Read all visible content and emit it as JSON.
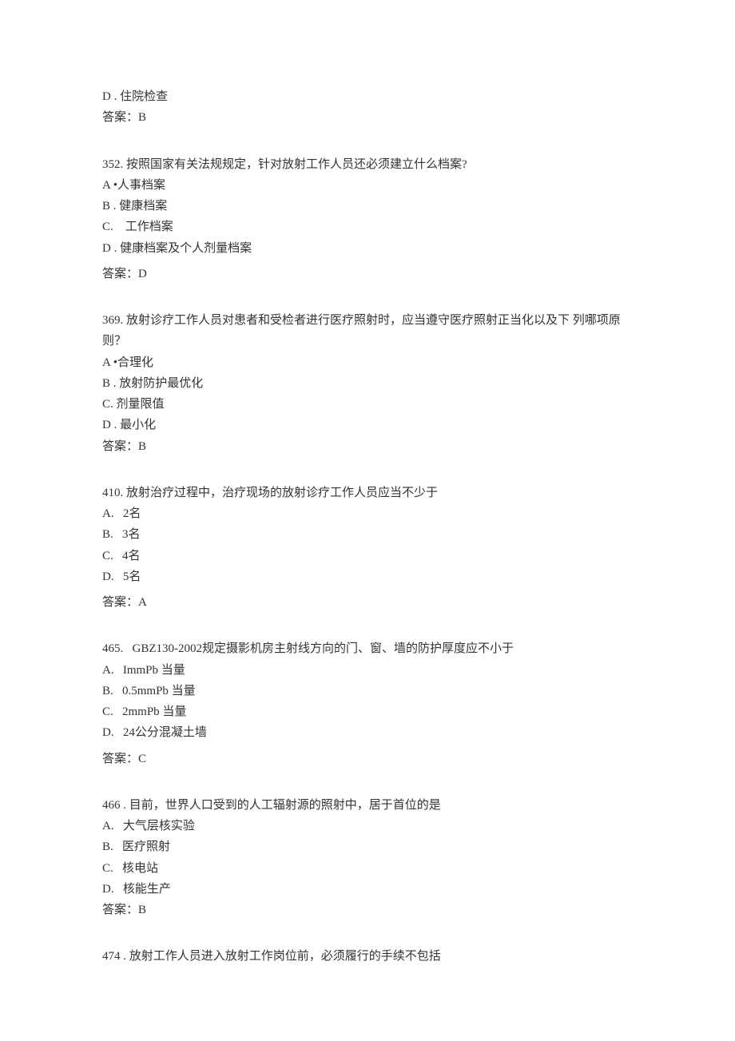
{
  "intro": {
    "optionD": "D . 住院检查",
    "answer": "答案：B"
  },
  "questions": [
    {
      "stem": "352. 按照国家有关法规规定，针对放射工作人员还必须建立什么档案?",
      "options": [
        "A •人事档案",
        "B . 健康档案",
        "C.    工作档案",
        "D . 健康档案及个人剂量档案"
      ],
      "answer": "答案：D",
      "answerSpaced": true
    },
    {
      "stem": "369. 放射诊疗工作人员对患者和受检者进行医疗照射时，应当遵守医疗照射正当化以及下 列哪项原则？",
      "options": [
        "A •合理化",
        "B . 放射防护最优化",
        "C. 剂量限值",
        "D . 最小化"
      ],
      "answer": "答案：B",
      "answerSpaced": false
    },
    {
      "stem": "410. 放射治疗过程中，治疗现场的放射诊疗工作人员应当不少于",
      "options": [
        "A.   2名",
        "B.   3名",
        "C.   4名",
        "D.   5名"
      ],
      "answer": "答案：A",
      "answerSpaced": true
    },
    {
      "stem": "465.   GBZ130-2002规定摄影机房主射线方向的门、窗、墙的防护厚度应不小于",
      "options": [
        "A.   ImmPb 当量",
        "B.   0.5mmPb 当量",
        "C.   2mmPb 当量",
        "D.   24公分混凝土墙"
      ],
      "answer": "答案：C",
      "answerSpaced": true
    },
    {
      "stem": "466 . 目前，世界人口受到的人工辐射源的照射中，居于首位的是",
      "options": [
        "A.   大气层核实验",
        "B.   医疗照射",
        "C.   核电站",
        "D.   核能生产"
      ],
      "answer": "答案：B",
      "answerSpaced": false
    },
    {
      "stem": "474 . 放射工作人员进入放射工作岗位前，必须履行的手续不包括",
      "options": [],
      "answer": "",
      "answerSpaced": false
    }
  ]
}
